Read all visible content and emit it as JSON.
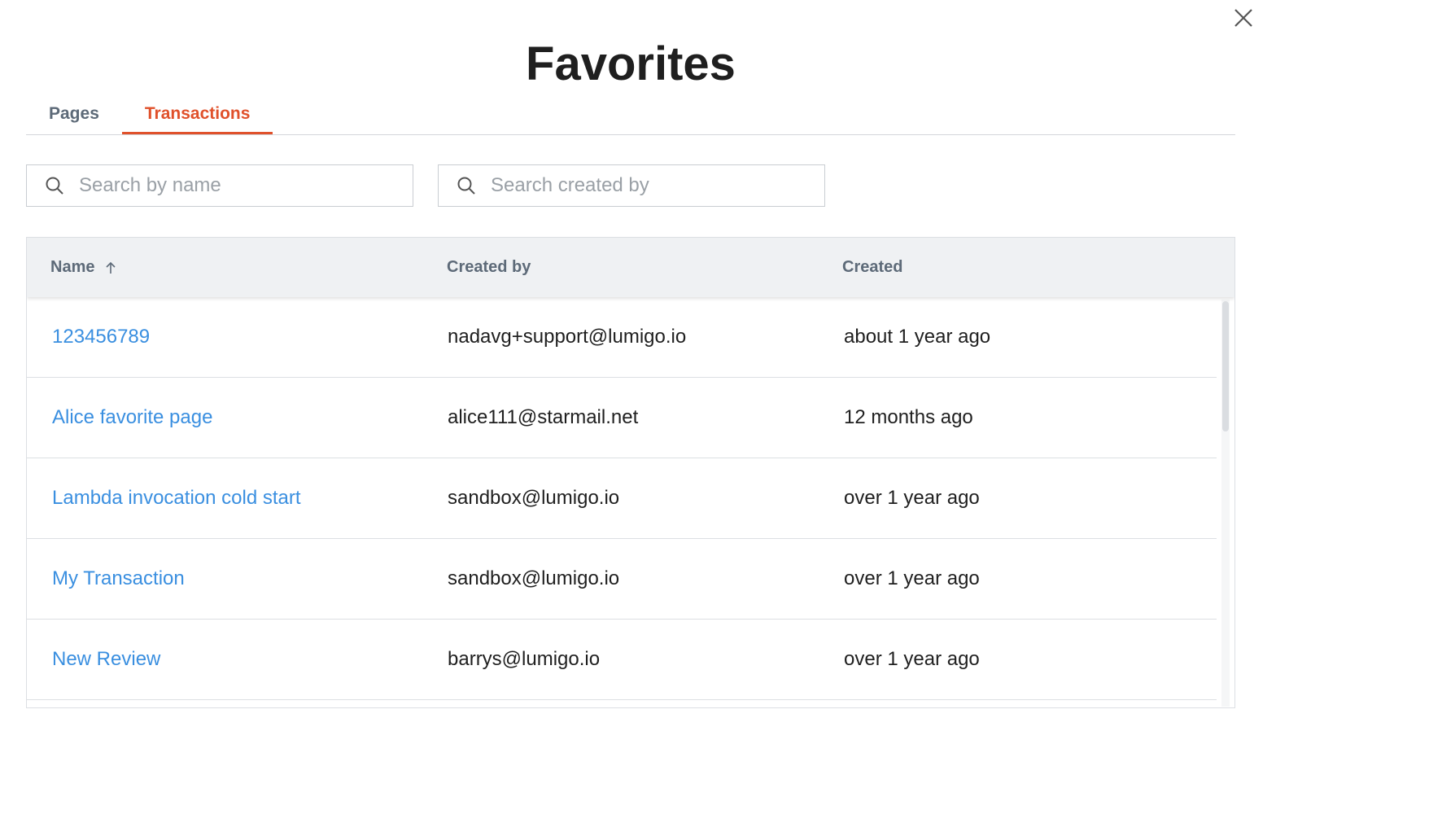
{
  "modal": {
    "title": "Favorites"
  },
  "tabs": [
    {
      "label": "Pages",
      "active": false
    },
    {
      "label": "Transactions",
      "active": true
    }
  ],
  "search": {
    "name_placeholder": "Search by name",
    "created_by_placeholder": "Search created by"
  },
  "table": {
    "columns": [
      "Name",
      "Created by",
      "Created"
    ],
    "sort": {
      "column": "Name",
      "direction": "ascending"
    },
    "rows": [
      {
        "name": "123456789",
        "created_by": "nadavg+support@lumigo.io",
        "created": "about 1 year ago"
      },
      {
        "name": "Alice favorite page",
        "created_by": "alice111@starmail.net",
        "created": "12 months ago"
      },
      {
        "name": "Lambda invocation cold start",
        "created_by": "sandbox@lumigo.io",
        "created": "over 1 year ago"
      },
      {
        "name": "My Transaction",
        "created_by": "sandbox@lumigo.io",
        "created": "over 1 year ago"
      },
      {
        "name": "New Review",
        "created_by": "barrys@lumigo.io",
        "created": "over 1 year ago"
      }
    ]
  },
  "colors": {
    "accent": "#e0512b",
    "link": "#3a8fe0",
    "header_bg": "#eff1f3",
    "muted_text": "#5d6a78"
  },
  "icons": {
    "close": "close-icon",
    "search": "search-icon",
    "sort": "arrow-up-icon"
  }
}
